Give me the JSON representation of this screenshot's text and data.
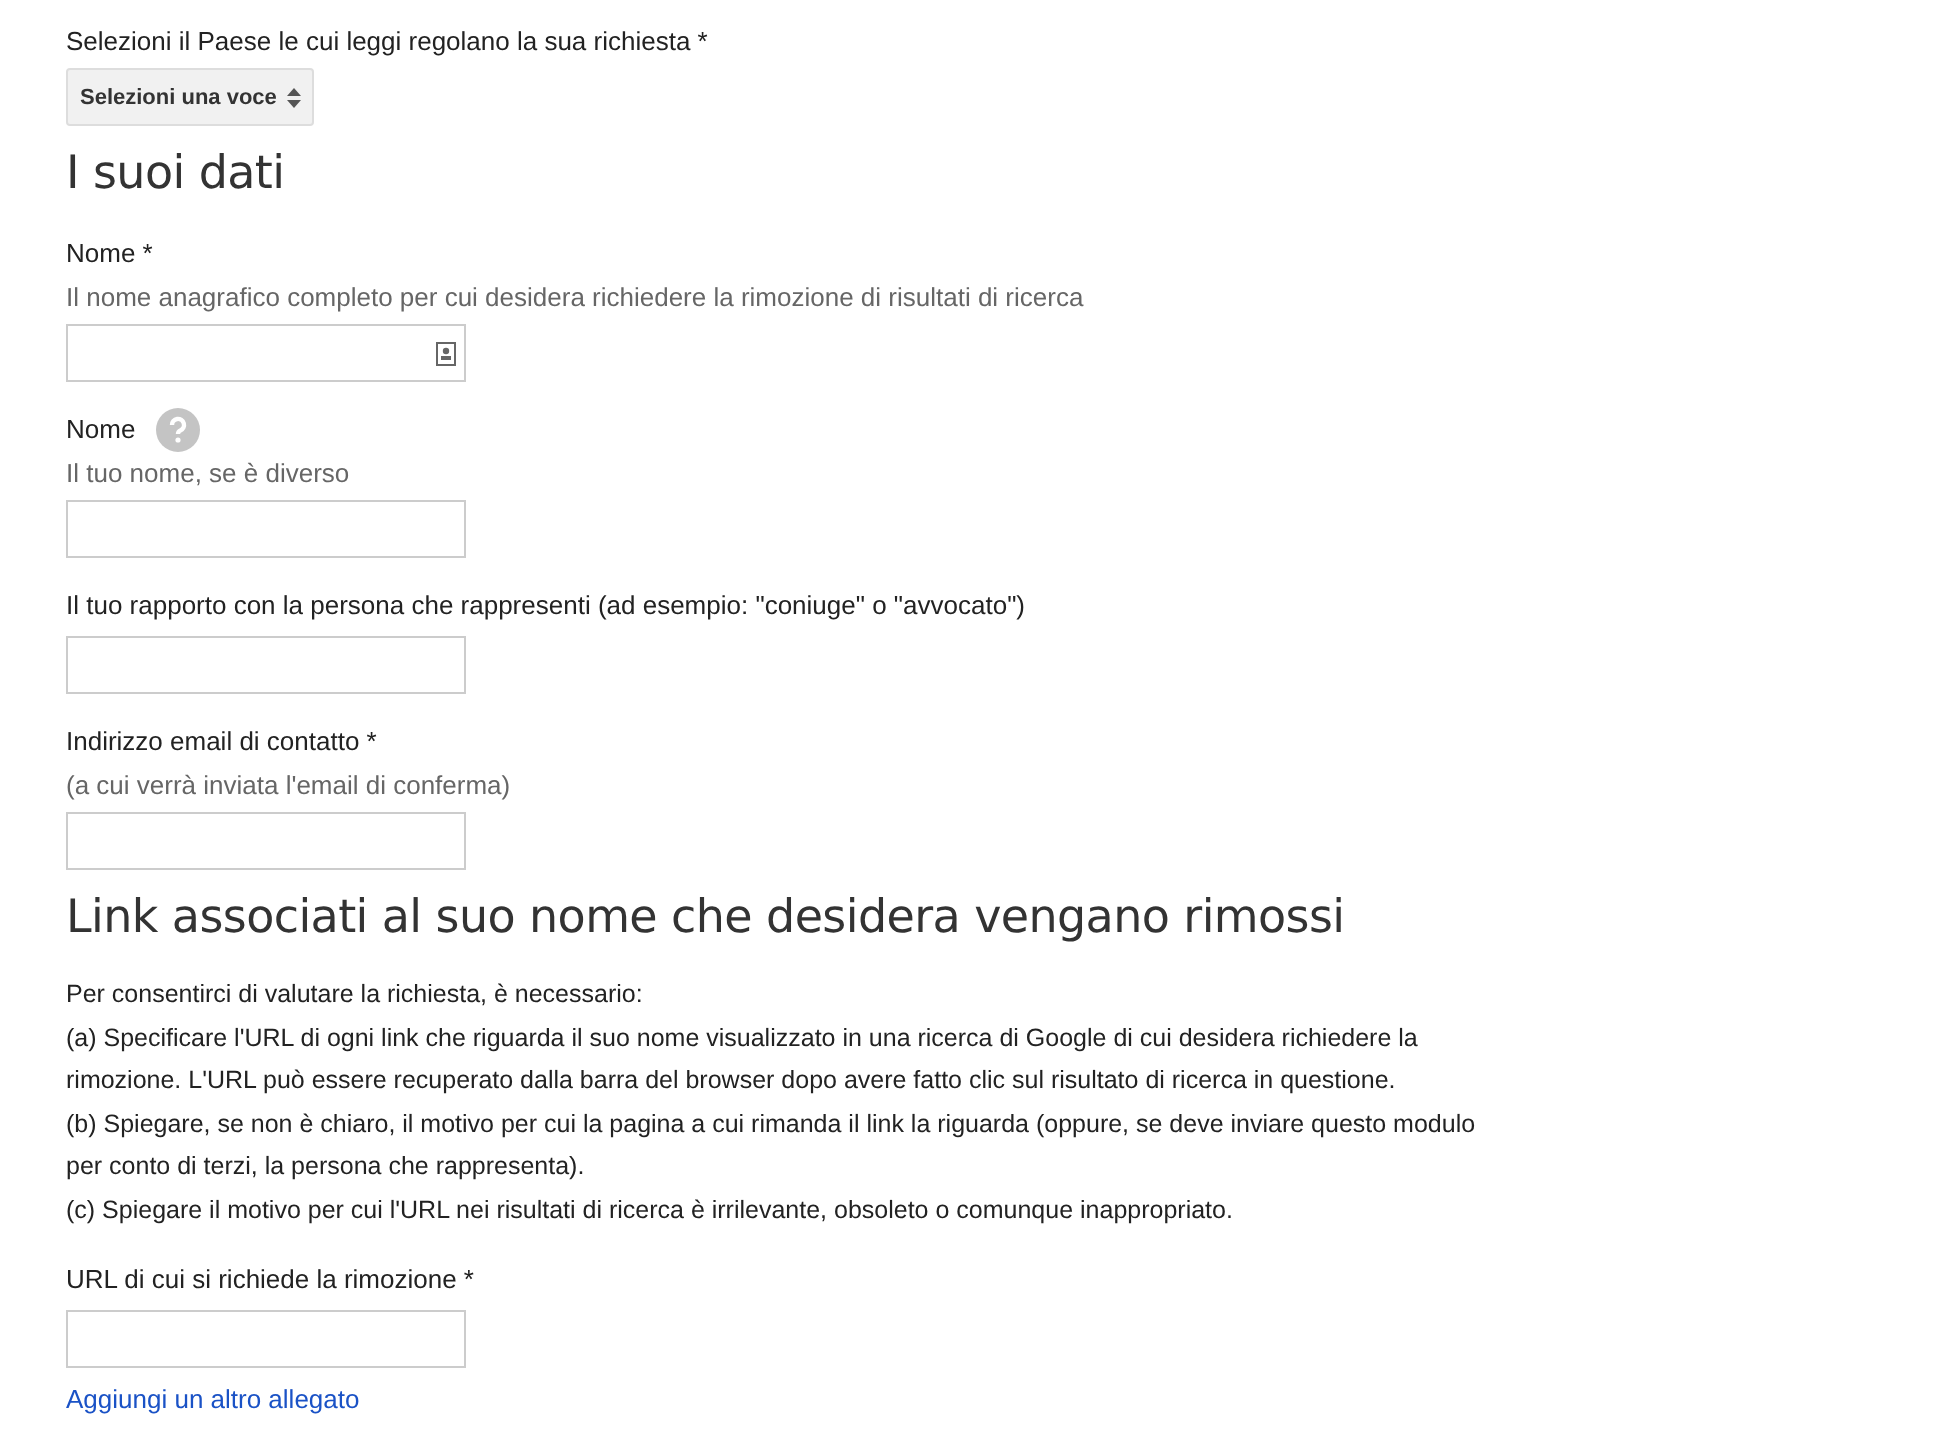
{
  "items": [
    {
      "kind": "select",
      "label": "Selezioni il Paese le cui leggi regolano la sua richiesta *",
      "value": "Selezioni una voce"
    },
    {
      "kind": "heading",
      "text": "I suoi dati"
    },
    {
      "kind": "field",
      "label": "Nome *",
      "hint": "Il nome anagrafico completo per cui desidera richiedere la rimozione di risultati di ricerca",
      "contact_icon": true
    },
    {
      "kind": "field",
      "label": "Nome",
      "hint": "Il tuo nome, se è diverso",
      "help": true
    },
    {
      "kind": "field",
      "label": "Il tuo rapporto con la persona che rappresenti (ad esempio: \"coniuge\" o \"avvocato\")"
    },
    {
      "kind": "field",
      "label": "Indirizzo email di contatto *",
      "hint": "(a cui verrà inviata l'email di conferma)"
    },
    {
      "kind": "heading",
      "text": "Link associati al suo nome che desidera vengano rimossi"
    },
    {
      "kind": "paragraph",
      "lines": [
        "Per consentirci di valutare la richiesta, è necessario:",
        "(a) Specificare l'URL di ogni link che riguarda il suo nome visualizzato in una ricerca di Google di cui desidera richiedere la rimozione. L'URL può essere recuperato dalla barra del browser dopo avere fatto clic sul risultato di ricerca in questione.",
        "(b) Spiegare, se non è chiaro, il motivo per cui la pagina a cui rimanda il link la riguarda (oppure, se deve inviare questo modulo per conto di terzi, la persona che rappresenta).",
        "(c) Spiegare il motivo per cui l'URL nei risultati di ricerca è irrilevante, obsoleto o comunque inappropriato."
      ]
    },
    {
      "kind": "field",
      "label": "URL di cui si richiede la rimozione *"
    },
    {
      "kind": "link",
      "text": "Aggiungi un altro allegato"
    }
  ]
}
